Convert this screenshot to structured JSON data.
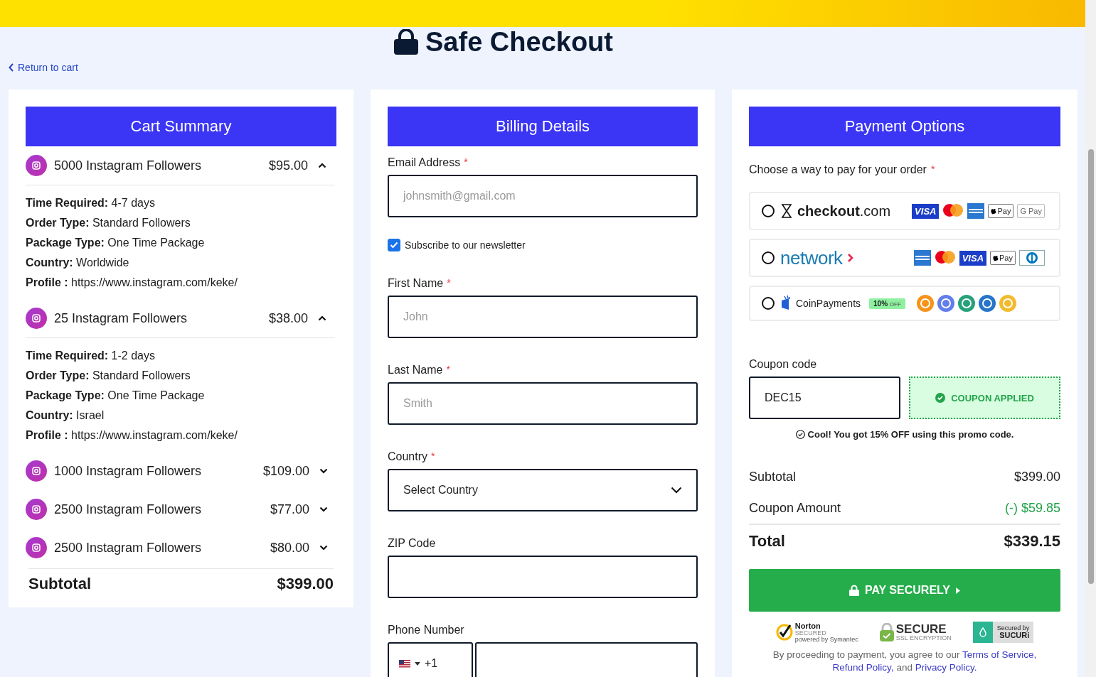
{
  "page_title": "Safe Checkout",
  "back_link": "Return to cart",
  "cart": {
    "title": "Cart Summary",
    "items": [
      {
        "name": "5000 Instagram Followers",
        "price": "$95.00",
        "expanded": true,
        "details": [
          "**Time Required:** 4-7 days",
          "**Order Type:** Standard Followers",
          "**Package Type:** One Time Package",
          "**Country:** Worldwide",
          "**Profile :** https://www.instagram.com/keke/"
        ]
      },
      {
        "name": "25 Instagram Followers",
        "price": "$38.00",
        "expanded": true,
        "details": [
          "**Time Required:** 1-2 days",
          "**Order Type:** Standard Followers",
          "**Package Type:** One Time Package",
          "**Country:** Israel",
          "**Profile :** https://www.instagram.com/keke/"
        ]
      },
      {
        "name": "1000 Instagram Followers",
        "price": "$109.00",
        "expanded": false
      },
      {
        "name": "2500 Instagram Followers",
        "price": "$77.00",
        "expanded": false
      },
      {
        "name": "2500 Instagram Followers",
        "price": "$80.00",
        "expanded": false
      }
    ],
    "subtotal_label": "Subtotal",
    "subtotal": "$399.00"
  },
  "billing": {
    "title": "Billing Details",
    "fields": [
      {
        "kind": "text",
        "label": "Email Address",
        "required_mark": "*",
        "placeholder": "johnsmith@gmail.com"
      },
      {
        "kind": "checkbox",
        "label": "Subscribe to our newsletter",
        "checked": true
      },
      {
        "kind": "text",
        "label": "First Name",
        "required_mark": "*",
        "placeholder": "John"
      },
      {
        "kind": "text",
        "label": "Last Name",
        "required_mark": "*",
        "placeholder": "Smith"
      },
      {
        "kind": "select",
        "label": "Country",
        "required_mark": "*",
        "value": "Select Country"
      },
      {
        "kind": "text",
        "label": "ZIP Code"
      },
      {
        "kind": "phone",
        "label": "Phone Number",
        "code": "+1"
      }
    ]
  },
  "payment": {
    "title": "Payment Options",
    "prompt": "Choose a way to pay for your order",
    "required_mark": "*",
    "options": [
      {
        "kind": "checkout",
        "selected": false,
        "brand": "checkout",
        "brand_suffix": ".com",
        "cards": [
          {
            "kind": "visa",
            "label": "VISA"
          },
          {
            "kind": "mastercard"
          },
          {
            "kind": "amex"
          },
          {
            "kind": "applepay",
            "label": "Pay"
          },
          {
            "kind": "googlepay",
            "label": "G Pay"
          }
        ]
      },
      {
        "kind": "network",
        "selected": false,
        "brand": "network",
        "cards": [
          {
            "kind": "amex"
          },
          {
            "kind": "mastercard"
          },
          {
            "kind": "visa",
            "label": "VISA"
          },
          {
            "kind": "applepay",
            "label": "Pay"
          },
          {
            "kind": "diners"
          }
        ]
      },
      {
        "kind": "coinpayments",
        "selected": false,
        "brand": "CoinPayments",
        "badge": "10%",
        "badge_suffix": "OFF",
        "coins": [
          {
            "color": "#f7931a"
          },
          {
            "color": "#627eea"
          },
          {
            "color": "#26a17b"
          },
          {
            "color": "#2775ca"
          },
          {
            "color": "#f3ba2f"
          }
        ]
      }
    ],
    "coupon": {
      "label": "Coupon code",
      "value": "DEC15",
      "status": "COUPON APPLIED",
      "message": "Cool! You got 15% OFF using this promo code."
    },
    "totals": [
      {
        "kind": "normal",
        "label": "Subtotal",
        "value": "$399.00"
      },
      {
        "kind": "discount",
        "label": "Coupon Amount",
        "value": "(-) $59.85"
      },
      {
        "kind": "total",
        "label": "Total",
        "value": "$339.15"
      }
    ],
    "pay_button": "PAY SECURELY",
    "trust": {
      "norton": "Norton",
      "norton_sub": "SECURED",
      "norton_by": "powered by Symantec",
      "secure": "SECURE",
      "secure_sub": "SSL ENCRYPTION",
      "sucuri_by": "Secured by",
      "sucuri": "SUCURi"
    },
    "terms": {
      "text": "By proceeding to payment, you agree to our",
      "links": [
        "Terms of Service,",
        "Refund Policy,"
      ],
      "joiner": "and",
      "last_link": "Privacy Policy."
    }
  }
}
